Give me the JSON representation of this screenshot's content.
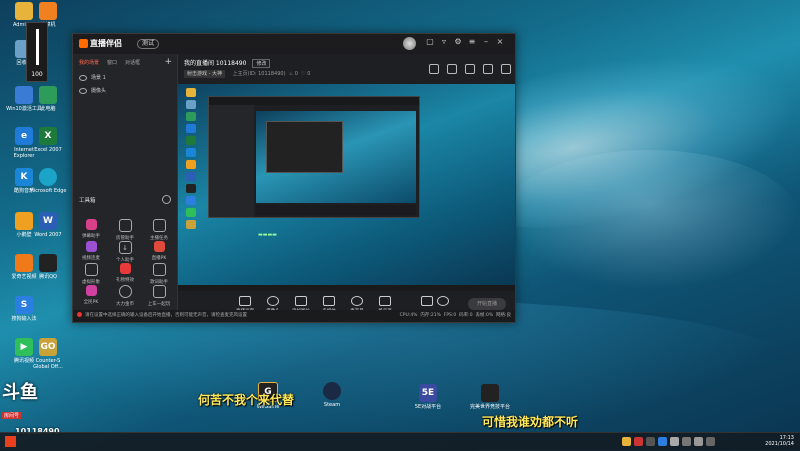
{
  "desktop": {
    "left_icons": [
      {
        "label": "Admini..."
      },
      {
        "label": "计算机"
      },
      {
        "label": "回收站"
      },
      {
        "label": "Win10激活工具"
      },
      {
        "label": "此电脑"
      },
      {
        "label": "Internet Explorer"
      },
      {
        "label": "Excel 2007"
      },
      {
        "label": "酷狗音乐"
      },
      {
        "label": "Microsoft Edge"
      },
      {
        "label": "小鹅壁"
      },
      {
        "label": "Word 2007"
      },
      {
        "label": "爱奇艺视频"
      },
      {
        "label": "腾讯QQ"
      },
      {
        "label": "搜狗输入法"
      },
      {
        "label": "腾讯视频"
      },
      {
        "label": "Counter-S Global Off..."
      }
    ],
    "bottom_icons": [
      {
        "label": "WeGame"
      },
      {
        "label": "Steam"
      },
      {
        "label": "5E对战平台"
      },
      {
        "label": "完美世界竞技平台"
      }
    ],
    "volume_popup": {
      "value": "100"
    },
    "danmu": [
      "何苦不我个来代替",
      "可惜我谁劝都不听"
    ],
    "watermark": {
      "brand": "斗鱼",
      "sub": "房间号",
      "room": "10118490"
    }
  },
  "app": {
    "brand": "直播伴侣",
    "version_badge": "测试",
    "left_tabs": [
      "我的场景",
      "窗口",
      "对话框"
    ],
    "scenes": [
      "场景 1",
      "摄像头"
    ],
    "tools_title": "工具箱",
    "tools": [
      {
        "label": "弹幕助手"
      },
      {
        "label": "房管助手"
      },
      {
        "label": "主播任务"
      },
      {
        "label": "视频连麦"
      },
      {
        "label": "个人助手"
      },
      {
        "label": "直播PK"
      },
      {
        "label": "虚拟形象"
      },
      {
        "label": "礼物特效"
      },
      {
        "label": "歌词助手"
      },
      {
        "label": "全民PK"
      },
      {
        "label": "大力金币"
      },
      {
        "label": "上车一起玩"
      }
    ],
    "room_title": "我的直播间 10118490",
    "edit_label": "修改",
    "category": "射击游戏 - 大神",
    "info_text": "上主页(ID: 10118490)",
    "heat": "0",
    "followers": "0",
    "controls": [
      "直播画面",
      "摄像头",
      "添加图片",
      "多媒体",
      "麦克风",
      "扬声器"
    ],
    "go_live": "开始直播",
    "status_text": "请在设置中选择正确的输入设备后开始直播，否则可能无声音，请检查麦克风设置",
    "status_right": [
      "CPU:4%",
      "内存:21%",
      "FPS:0",
      "码率:0",
      "丢帧:0%",
      "网络:良"
    ]
  },
  "taskbar": {
    "time": "17:13",
    "date": "2021/10/14"
  }
}
